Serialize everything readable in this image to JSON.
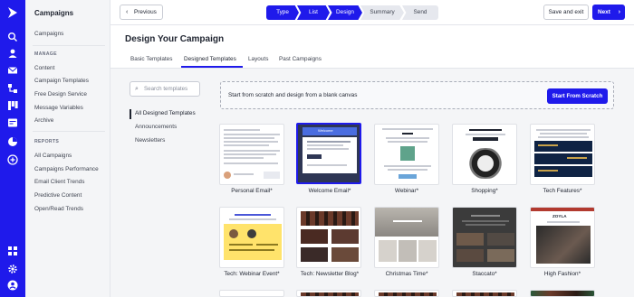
{
  "sidenav": {
    "title": "Campaigns",
    "campaigns_link": "Campaigns",
    "manage_heading": "MANAGE",
    "manage_items": [
      "Content",
      "Campaign Templates",
      "Free Design Service",
      "Message Variables",
      "Archive"
    ],
    "reports_heading": "REPORTS",
    "report_items": [
      "All Campaigns",
      "Campaigns Performance",
      "Email Client Trends",
      "Predictive Content",
      "Open/Read Trends"
    ]
  },
  "topbar": {
    "previous_label": "Previous",
    "steps": [
      "Type",
      "List",
      "Design",
      "Summary",
      "Send"
    ],
    "save_exit_label": "Save and exit",
    "next_label": "Next"
  },
  "main": {
    "title": "Design Your Campaign",
    "tabs": [
      "Basic Templates",
      "Designed Templates",
      "Layouts",
      "Past Campaigns"
    ]
  },
  "filters": {
    "search_placeholder": "Search templates",
    "items": [
      "All Designed Templates",
      "Announcements",
      "Newsletters"
    ]
  },
  "blank_canvas": {
    "text": "Start from scratch and design from a blank canvas",
    "button_label": "Start From Scratch"
  },
  "templates": {
    "row1": [
      "Personal Email*",
      "Welcome Email*",
      "Webinar*",
      "Shopping*",
      "Tech Features*"
    ],
    "row2": [
      "Tech: Webinar Event*",
      "Tech: Newsletter Blog*",
      "Christmas Time*",
      "Staccato*",
      "High Fashion*"
    ]
  },
  "thumb_text": {
    "welcome_banner": "Welcome",
    "fashion_title": "ZOYLA"
  },
  "colors": {
    "brand": "#1f1aeb",
    "welcome_dark": "#2e3654",
    "tech_navy": "#0f2344",
    "webinar_yellow": "#ffe36b",
    "staccato_dark": "#3b3b3b",
    "fashion_red": "#b23a2f"
  }
}
